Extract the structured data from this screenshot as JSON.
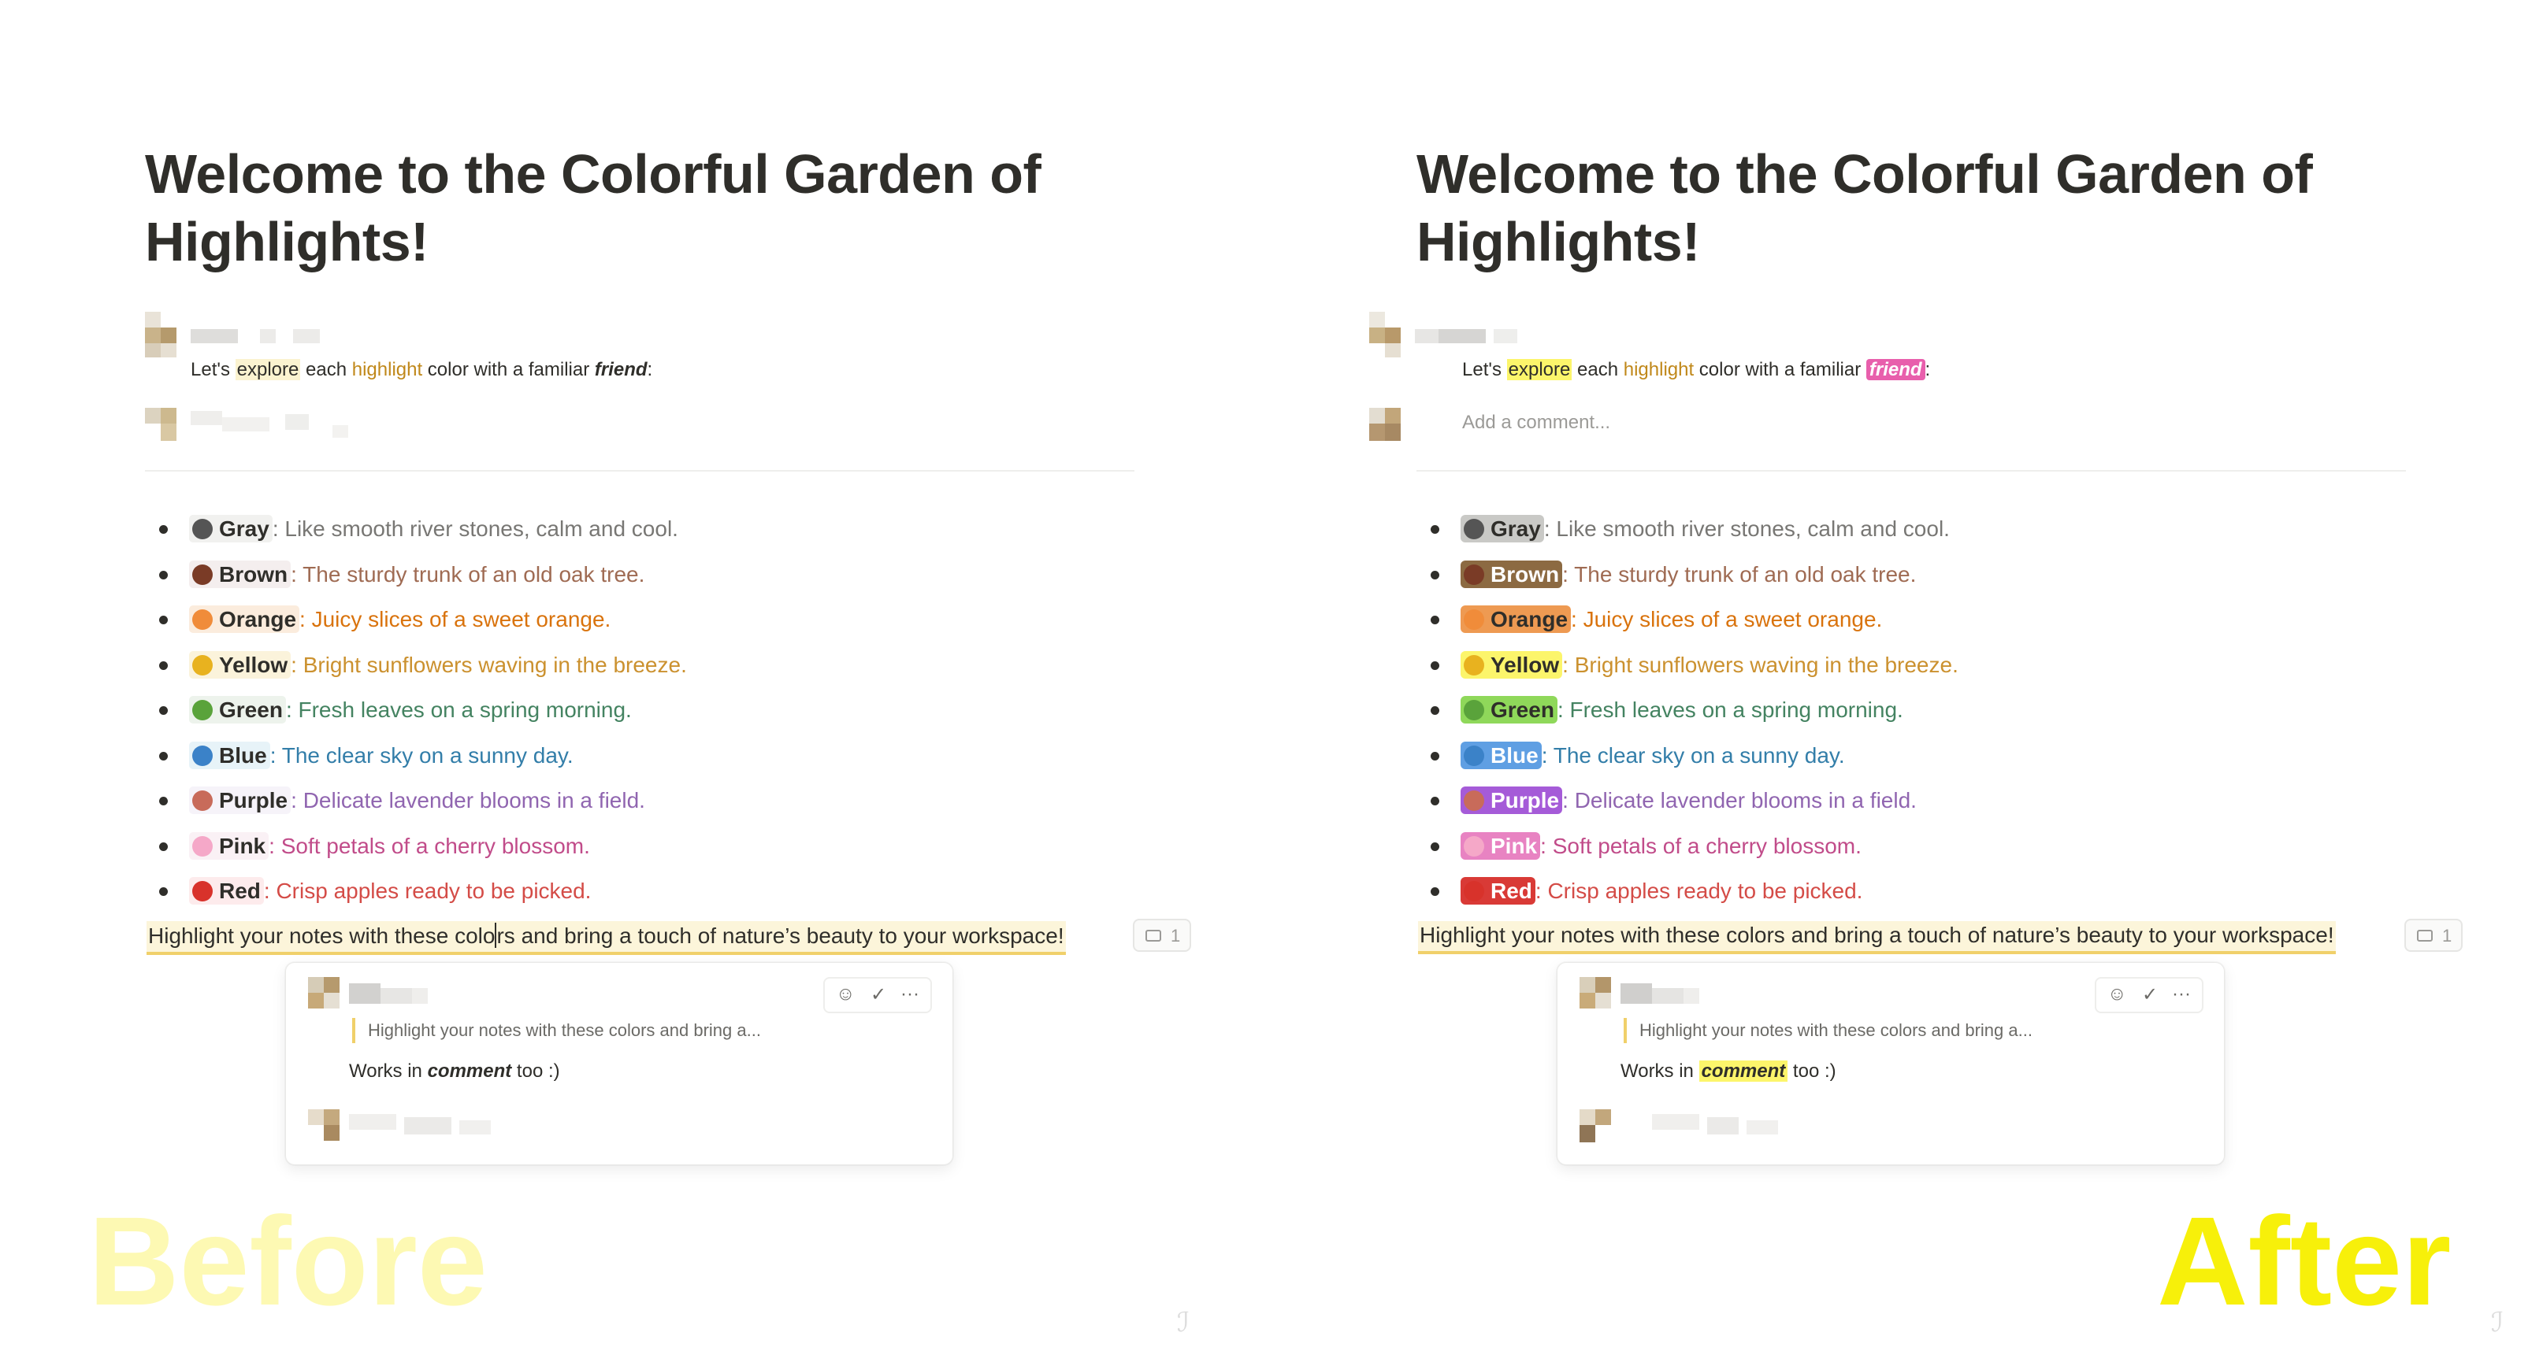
{
  "before": {
    "label": "Before",
    "title": "Welcome to the Colorful Garden of Highlights!",
    "comment": {
      "part1": "Let's ",
      "explore": "explore",
      "part2": " each ",
      "highlight": "highlight",
      "part3": " color with a familiar ",
      "friend": "friend",
      "part4": ":"
    },
    "bottom_line": {
      "text_a": "Highlight your notes with these colo",
      "text_b": "rs and bring a touch of nature’s beauty to your workspace!"
    },
    "comment_count": "1",
    "card": {
      "actions": {
        "emoji": "☺",
        "resolve": "✓",
        "more": "···"
      },
      "quote": "Highlight your notes with these colors and bring a...",
      "works_a": "Works in ",
      "works_kw": "comment",
      "works_b": " too :)"
    }
  },
  "after": {
    "label": "After",
    "title": "Welcome to the Colorful Garden of Highlights!",
    "comment": {
      "part1": "Let's ",
      "explore": "explore",
      "part2": " each ",
      "highlight": "highlight",
      "part3": " color with a familiar ",
      "friend": "friend",
      "part4": ":"
    },
    "add_comment_placeholder": "Add a comment...",
    "bottom_line": {
      "text": "Highlight your notes with these colors and bring a touch of nature’s beauty to your workspace!"
    },
    "comment_count": "1",
    "card": {
      "actions": {
        "emoji": "☺",
        "resolve": "✓",
        "more": "···"
      },
      "quote": "Highlight your notes with these colors and bring a...",
      "works_a": "Works in ",
      "works_kw": "comment",
      "works_b": " too :)"
    }
  },
  "colors": [
    {
      "name": "Gray",
      "text": ": Like smooth river stones, calm and cool.",
      "emoji": "rock-icon",
      "emoji_color": "#555555",
      "text_color": "#787774",
      "bg_before": "#f1f1ef",
      "bg_after": "#c9c9c6",
      "name_color_after": "#2f2e2a"
    },
    {
      "name": "Brown",
      "text": ": The sturdy trunk of an old oak tree.",
      "emoji": "chestnut-icon",
      "emoji_color": "#7a3b26",
      "text_color": "#9f6b53",
      "bg_before": "#f4eeee",
      "bg_after": "#8c6a42",
      "name_color_after": "#ffffff"
    },
    {
      "name": "Orange",
      "text": ": Juicy slices of a sweet orange.",
      "emoji": "peach-icon",
      "emoji_color": "#f08c3a",
      "text_color": "#d9730d",
      "bg_before": "#fbecdd",
      "bg_after": "#ee9a52",
      "name_color_after": "#2f2e2a"
    },
    {
      "name": "Yellow",
      "text": ": Bright sunflowers waving in the breeze.",
      "emoji": "sunflower-icon",
      "emoji_color": "#e8b21f",
      "text_color": "#cb912f",
      "bg_before": "#fbf3db",
      "bg_after": "#fcf56b",
      "name_color_after": "#2f2e2a"
    },
    {
      "name": "Green",
      "text": ": Fresh leaves on a spring morning.",
      "emoji": "herb-icon",
      "emoji_color": "#5aa33b",
      "text_color": "#448361",
      "bg_before": "#edf3ec",
      "bg_after": "#8fd85a",
      "name_color_after": "#2f2e2a"
    },
    {
      "name": "Blue",
      "text": ": The clear sky on a sunny day.",
      "emoji": "wave-icon",
      "emoji_color": "#3b82c8",
      "text_color": "#337ea9",
      "bg_before": "#e7f3f8",
      "bg_after": "#5f9fe3",
      "name_color_after": "#ffffff"
    },
    {
      "name": "Purple",
      "text": ": Delicate lavender blooms in a field.",
      "emoji": "bouquet-icon",
      "emoji_color": "#c86b5a",
      "text_color": "#9065b0",
      "bg_before": "#f6f3f9",
      "bg_after": "#a55bd8",
      "name_color_after": "#ffffff"
    },
    {
      "name": "Pink",
      "text": ": Soft petals of a cherry blossom.",
      "emoji": "cherry-blossom-icon",
      "emoji_color": "#f5a8c8",
      "text_color": "#c14c8a",
      "bg_before": "#faf1f5",
      "bg_after": "#e883c2",
      "name_color_after": "#ffffff"
    },
    {
      "name": "Red",
      "text": ": Crisp apples ready to be picked.",
      "emoji": "apple-icon",
      "emoji_color": "#d8322b",
      "text_color": "#d44c47",
      "bg_before": "#fdebec",
      "bg_after": "#d93a36",
      "name_color_after": "#ffffff"
    }
  ]
}
